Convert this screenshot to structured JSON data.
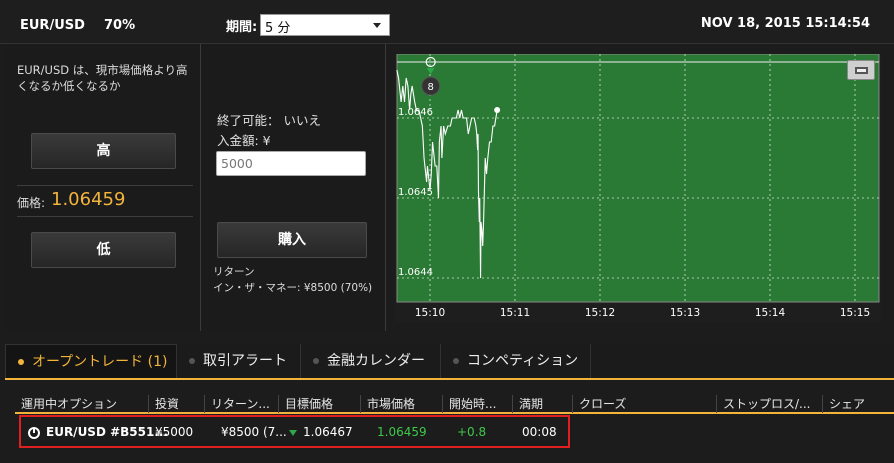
{
  "topbar": {
    "symbol": "EUR/USD",
    "payout": "70%",
    "period_label": "期間:",
    "period_value": "5 分",
    "datetime": "NOV 18, 2015 15:14:54"
  },
  "left": {
    "description": "EUR/USD は、現市場価格より高くなるか低くなるか",
    "high_label": "高",
    "price_label": "価格:",
    "price_value": "1.06459",
    "low_label": "低"
  },
  "middle": {
    "closable": "終了可能： いいえ",
    "deposit_label": "入金額: ¥",
    "amount_value": "5000",
    "buy_label": "購入",
    "return_label": "リターン",
    "itm_money": "イン・ザ・マネー: ¥8500 (70%)"
  },
  "chart_data": {
    "type": "line",
    "y_ticks": [
      "1.0646",
      "1.0645",
      "1.0644"
    ],
    "x_ticks": [
      "15:10",
      "15:11",
      "15:12",
      "15:13",
      "15:14",
      "15:15"
    ],
    "marker_label": "8",
    "ylim": [
      1.06437,
      1.06468
    ],
    "entry_price": 1.06467,
    "background_color": "#2a7a35",
    "line_color": "#ffffff",
    "series": [
      {
        "values": [
          [
            0.0,
            1.06466
          ],
          [
            0.02,
            1.06465
          ],
          [
            0.05,
            1.06462
          ],
          [
            0.07,
            1.06464
          ],
          [
            0.09,
            1.06462
          ],
          [
            0.11,
            1.06465
          ],
          [
            0.13,
            1.06464
          ],
          [
            0.15,
            1.06461
          ],
          [
            0.165,
            1.06463
          ],
          [
            0.18,
            1.06464
          ],
          [
            0.21,
            1.06462
          ],
          [
            0.23,
            1.06461
          ],
          [
            0.26,
            1.06461
          ],
          [
            0.3,
            1.06459
          ],
          [
            0.32,
            1.06455
          ],
          [
            0.35,
            1.06452
          ],
          [
            0.36,
            1.06454
          ],
          [
            0.38,
            1.06452
          ],
          [
            0.39,
            1.06451
          ],
          [
            0.405,
            1.06453
          ],
          [
            0.42,
            1.06457
          ],
          [
            0.45,
            1.06454
          ],
          [
            0.47,
            1.06454
          ],
          [
            0.49,
            1.0645
          ],
          [
            0.5,
            1.06457
          ],
          [
            0.52,
            1.06459
          ],
          [
            0.53,
            1.06455
          ],
          [
            0.55,
            1.06459
          ],
          [
            0.57,
            1.06458
          ],
          [
            0.6,
            1.06459
          ],
          [
            0.63,
            1.06459
          ],
          [
            0.65,
            1.0646
          ],
          [
            0.67,
            1.0646
          ],
          [
            0.7,
            1.0646
          ],
          [
            0.72,
            1.06461
          ],
          [
            0.74,
            1.0646
          ],
          [
            0.76,
            1.06461
          ],
          [
            0.78,
            1.0646
          ],
          [
            0.8,
            1.0646
          ],
          [
            0.82,
            1.0646
          ],
          [
            0.84,
            1.06458
          ],
          [
            0.86,
            1.06459
          ],
          [
            0.88,
            1.0646
          ],
          [
            0.89,
            1.0646
          ],
          [
            0.91,
            1.0646
          ],
          [
            0.93,
            1.06459
          ],
          [
            0.94,
            1.06458
          ],
          [
            0.95,
            1.06456
          ],
          [
            0.955,
            1.06458
          ],
          [
            0.96,
            1.06451
          ],
          [
            0.97,
            1.06447
          ],
          [
            0.975,
            1.0645
          ],
          [
            0.985,
            1.0644
          ],
          [
            0.99,
            1.06447
          ],
          [
            1.0,
            1.06446
          ],
          [
            1.01,
            1.06444
          ],
          [
            1.02,
            1.06447
          ],
          [
            1.04,
            1.06455
          ],
          [
            1.055,
            1.06453
          ],
          [
            1.07,
            1.06455
          ],
          [
            1.09,
            1.06457
          ],
          [
            1.11,
            1.06457
          ],
          [
            1.13,
            1.06459
          ],
          [
            1.15,
            1.06459
          ],
          [
            1.165,
            1.0646
          ],
          [
            1.18,
            1.06461
          ]
        ]
      }
    ]
  },
  "tabs": [
    {
      "label": "オープントレード (1)"
    },
    {
      "label": "取引アラート"
    },
    {
      "label": "金融カレンダー"
    },
    {
      "label": "コンペティション"
    }
  ],
  "table": {
    "headers": [
      "運用中オプション",
      "投資",
      "リターン...",
      "目標価格",
      "市場価格",
      "開始時...",
      "満期",
      "クローズ",
      "ストップロス/...",
      "シェア"
    ],
    "row": {
      "option": "EUR/USD #B551...",
      "investment": "¥5000",
      "return": "¥8500 (7...",
      "target": "1.06467",
      "market": "1.06459",
      "change": "+0.8",
      "expiry": "00:08"
    }
  }
}
